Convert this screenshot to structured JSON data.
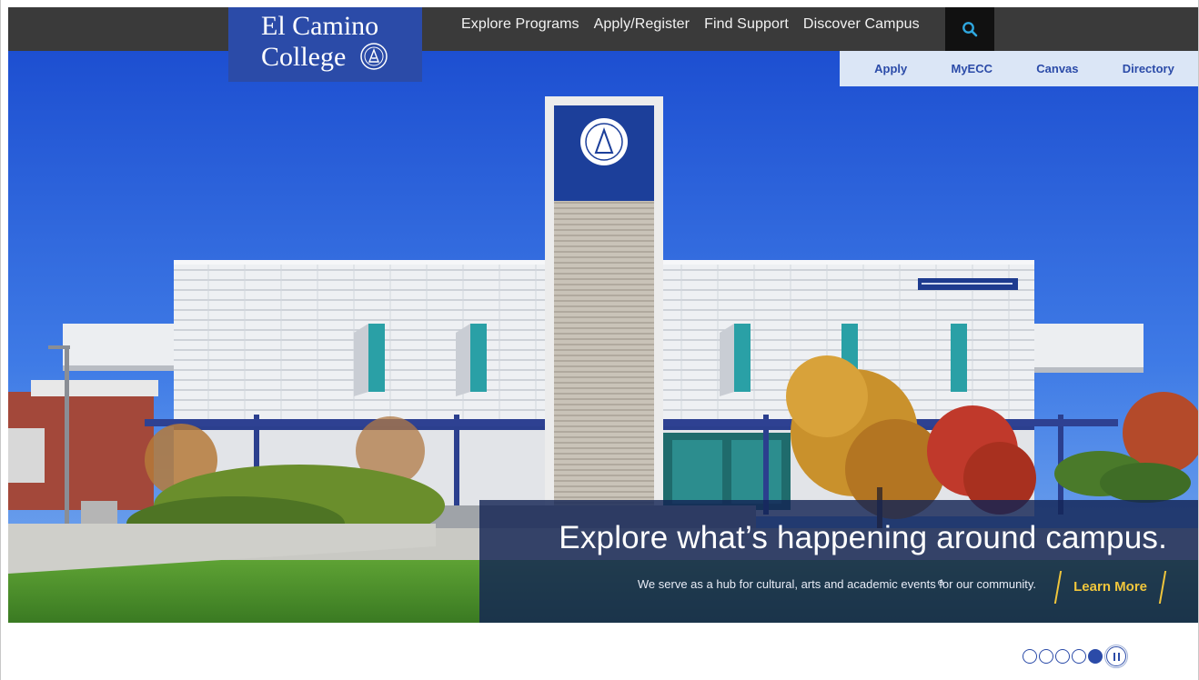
{
  "logo": {
    "line1": "El Camino",
    "line2": "College"
  },
  "nav": {
    "items": [
      "Explore Programs",
      "Apply/Register",
      "Find Support",
      "Discover Campus"
    ]
  },
  "quicklinks": [
    "Apply",
    "MyECC",
    "Canvas",
    "Directory"
  ],
  "hero": {
    "headline": "Explore what’s happening around campus.",
    "subtext": "We serve as a hub for cultural, arts and academic events for our community.",
    "cta": "Learn More"
  },
  "slider": {
    "slide_count": 5,
    "active_index": 4
  },
  "colors": {
    "brand_blue": "#2b4ba8",
    "nav_dark": "#3a3a3a",
    "quicklinks_bg": "#dbe6f6",
    "cta_gold": "#f0c63c"
  },
  "icons": {
    "search": "search-icon",
    "pause": "pause-icon",
    "seal": "college-seal-icon"
  }
}
